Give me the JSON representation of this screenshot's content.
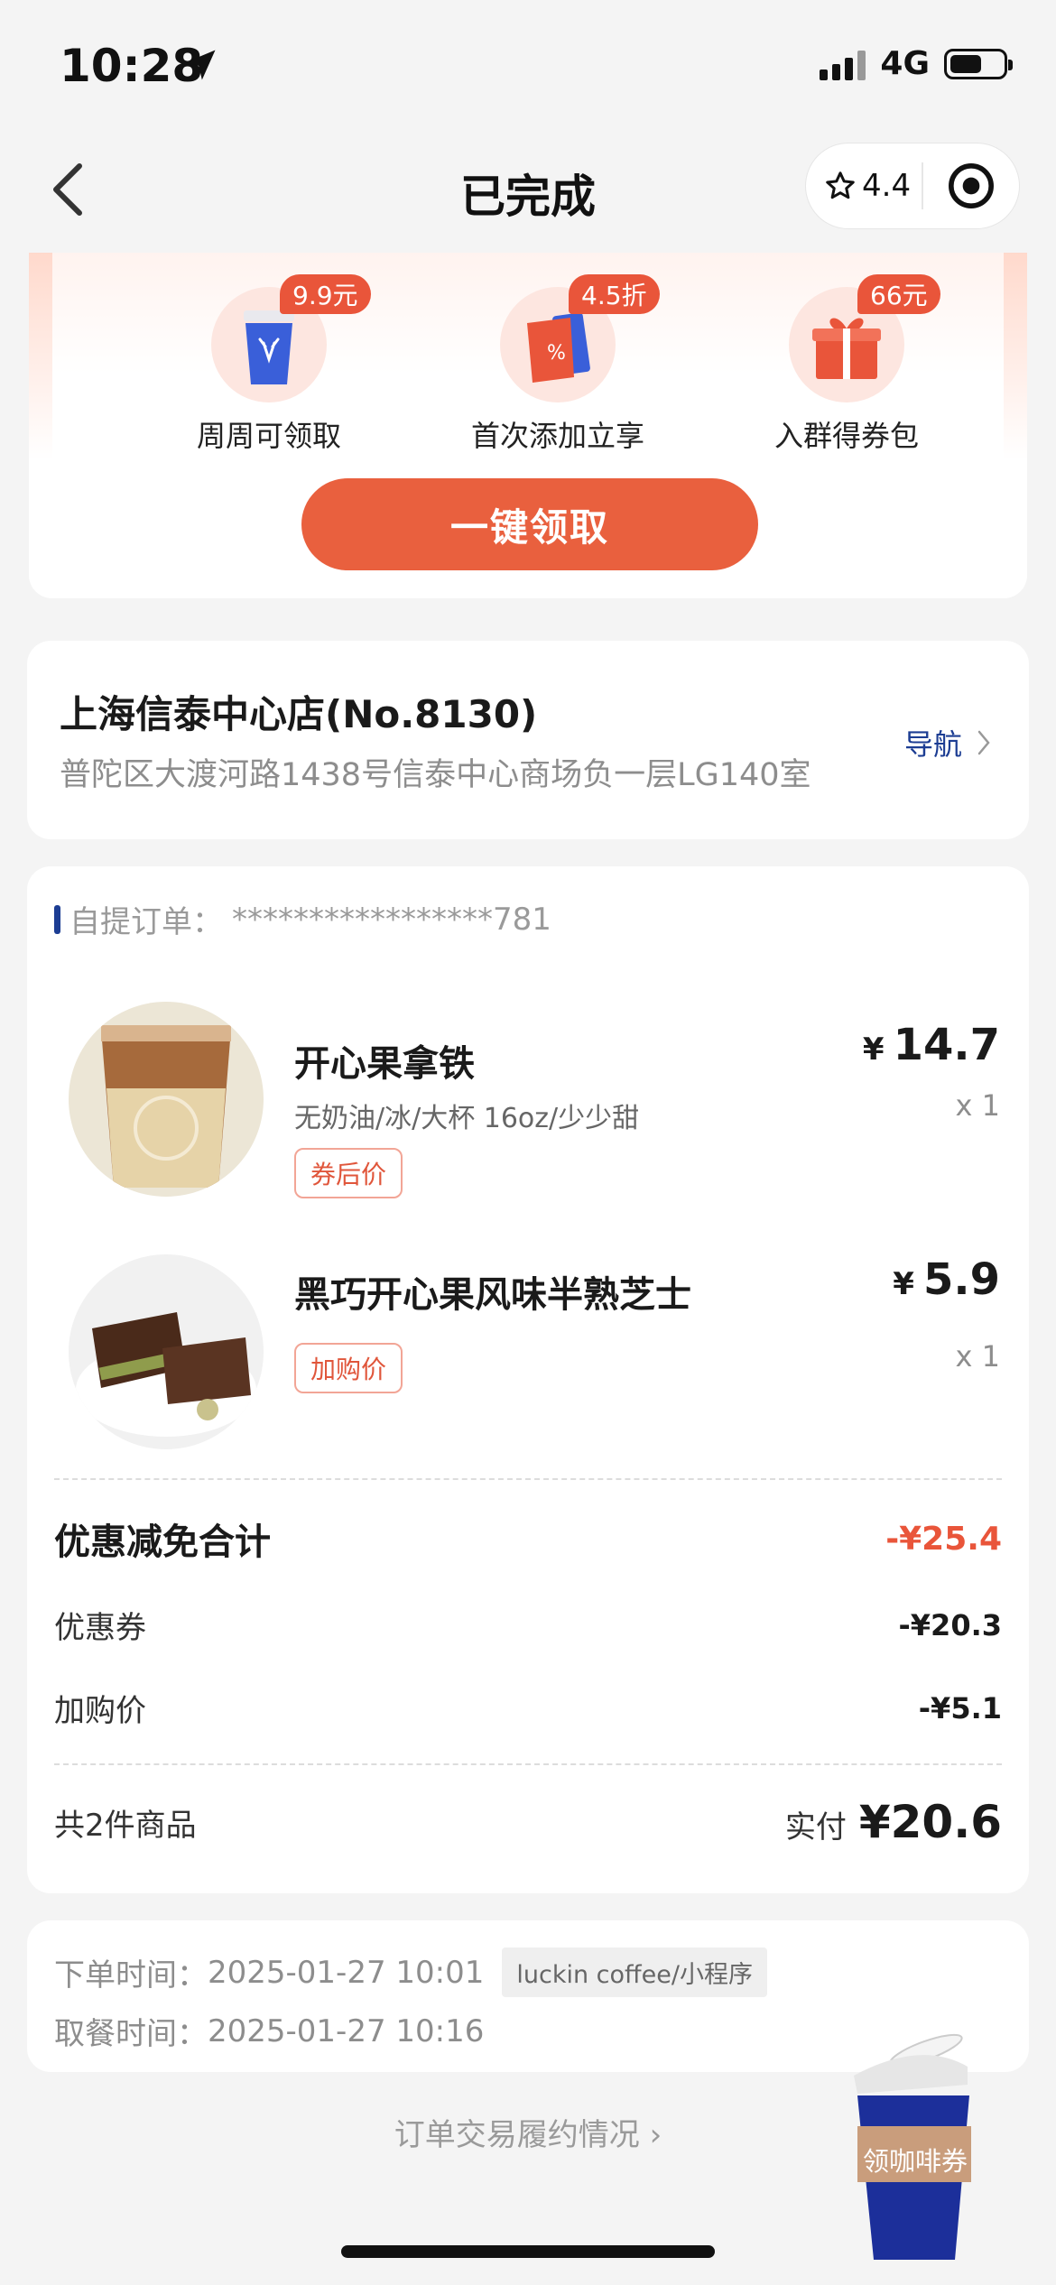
{
  "status_bar": {
    "time": "10:28",
    "network": "4G"
  },
  "nav": {
    "title": "已完成",
    "rating": "4.4"
  },
  "promo": {
    "perks": [
      {
        "badge": "9.9元",
        "label": "周周可领取",
        "icon": "coffee-cup-icon"
      },
      {
        "badge": "4.5折",
        "label": "首次添加立享",
        "icon": "coupon-icon"
      },
      {
        "badge": "66元",
        "label": "入群得券包",
        "icon": "gift-icon"
      }
    ],
    "claim_button": "一键领取"
  },
  "store": {
    "name": "上海信泰中心店(No.8130)",
    "address": "普陀区大渡河路1438号信泰中心商场负一层LG140室",
    "nav_label": "导航"
  },
  "order": {
    "number_label": "自提订单：",
    "number": "*****************781",
    "items": [
      {
        "name": "开心果拿铁",
        "spec": "无奶油/冰/大杯 16oz/少少甜",
        "tag": "券后价",
        "currency": "¥",
        "price": "14.7",
        "qty": "x 1"
      },
      {
        "name": "黑巧开心果风味半熟芝士",
        "spec": "",
        "tag": "加购价",
        "currency": "¥",
        "price": "5.9",
        "qty": "x 1"
      }
    ],
    "discount_total_label": "优惠减免合计",
    "discount_total": "-¥25.4",
    "coupon_label": "优惠券",
    "coupon_value": "-¥20.3",
    "addon_label": "加购价",
    "addon_value": "-¥5.1",
    "count_label": "共2件商品",
    "paid_label": "实付",
    "paid_amount": "¥20.6"
  },
  "times": {
    "order_time_label": "下单时间：",
    "order_time": "2025-01-27 10:01",
    "source": "luckin coffee/小程序",
    "pickup_time_label": "取餐时间：",
    "pickup_time": "2025-01-27 10:16"
  },
  "footer": {
    "link": "订单交易履约情况"
  },
  "floating": {
    "label": "领咖啡券"
  },
  "colors": {
    "accent": "#e9553a",
    "brand_blue": "#1c3d93"
  }
}
